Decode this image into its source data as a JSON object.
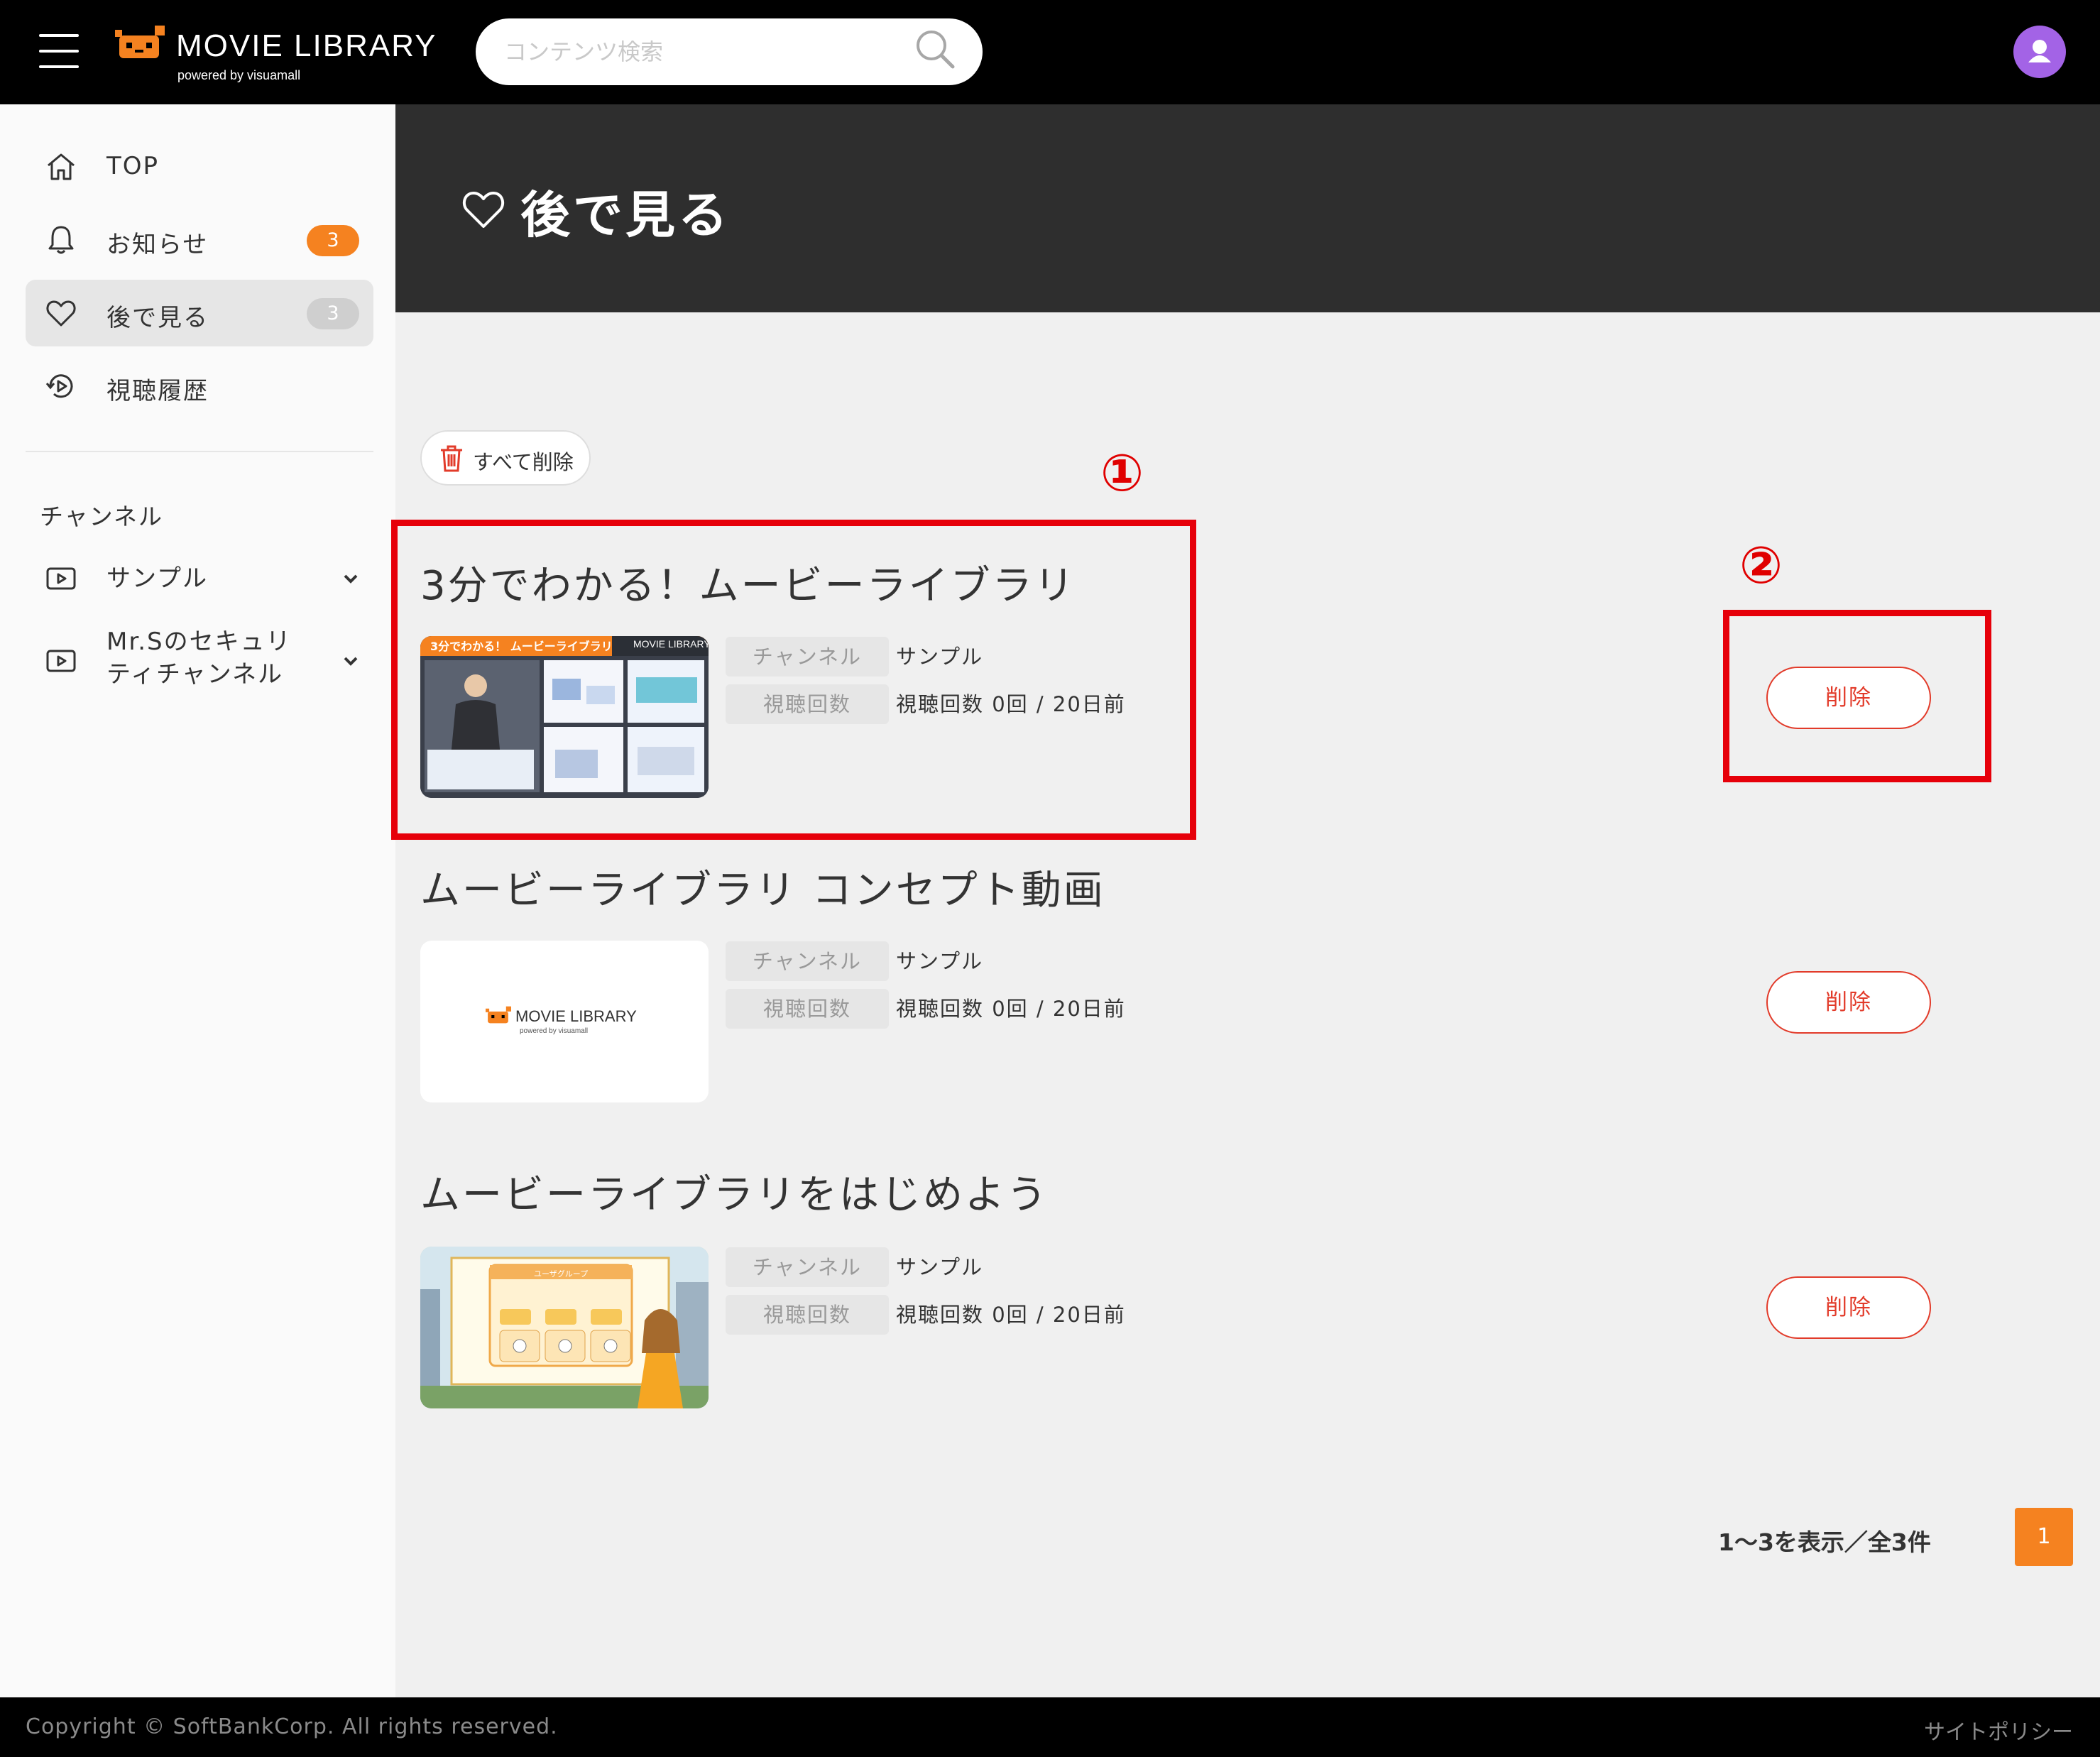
{
  "header": {
    "logo_title": "MOVIE LIBRARY",
    "logo_sub": "powered by visuamall",
    "search_placeholder": "コンテンツ検索"
  },
  "sidebar": {
    "nav": [
      {
        "label": "TOP",
        "icon": "home-icon"
      },
      {
        "label": "お知らせ",
        "icon": "bell-icon",
        "badge": "3",
        "badge_color": "#f58220"
      },
      {
        "label": "後で見る",
        "icon": "heart-icon",
        "badge": "3",
        "badge_color": "#cfcfcf",
        "active": true
      },
      {
        "label": "視聴履歴",
        "icon": "history-icon"
      }
    ],
    "channel_heading": "チャンネル",
    "channels": [
      {
        "label": "サンプル",
        "icon": "video-icon"
      },
      {
        "label_line1": "Mr.Sのセキュリ",
        "label_line2": "ティチャンネル",
        "icon": "video-icon"
      }
    ]
  },
  "page": {
    "title": "後で見る",
    "delete_all_label": "すべて削除"
  },
  "annotations": {
    "marker1": "①",
    "marker2": "②",
    "highlight_color": "#e6000a"
  },
  "videos": [
    {
      "title": "3分でわかる！ムービーライブラリ",
      "channel_key": "チャンネル",
      "channel_value": "サンプル",
      "views_key": "視聴回数",
      "views_value": "視聴回数 0回 / 20日前",
      "delete_label": "削除",
      "thumb_banner": "3分でわかる！ ムービーライブラリ",
      "thumb_logo": "MOVIE LIBRARY"
    },
    {
      "title": "ムービーライブラリ コンセプト動画",
      "channel_key": "チャンネル",
      "channel_value": "サンプル",
      "views_key": "視聴回数",
      "views_value": "視聴回数 0回 / 20日前",
      "delete_label": "削除",
      "thumb_logo": "MOVIE LIBRARY",
      "thumb_logo_sub": "powered by visuamall"
    },
    {
      "title": "ムービーライブラリをはじめよう",
      "channel_key": "チャンネル",
      "channel_value": "サンプル",
      "views_key": "視聴回数",
      "views_value": "視聴回数 0回 / 20日前",
      "delete_label": "削除",
      "thumb_banner": "ユーザグループ"
    }
  ],
  "pagination": {
    "summary": "1〜3を表示／全3件",
    "current_page": "1"
  },
  "footer": {
    "copyright": "Copyright © SoftBankCorp. All rights reserved.",
    "policy": "サイトポリシー"
  },
  "colors": {
    "accent": "#f58220",
    "delete_red": "#e23b2a",
    "avatar": "#a363e6"
  }
}
